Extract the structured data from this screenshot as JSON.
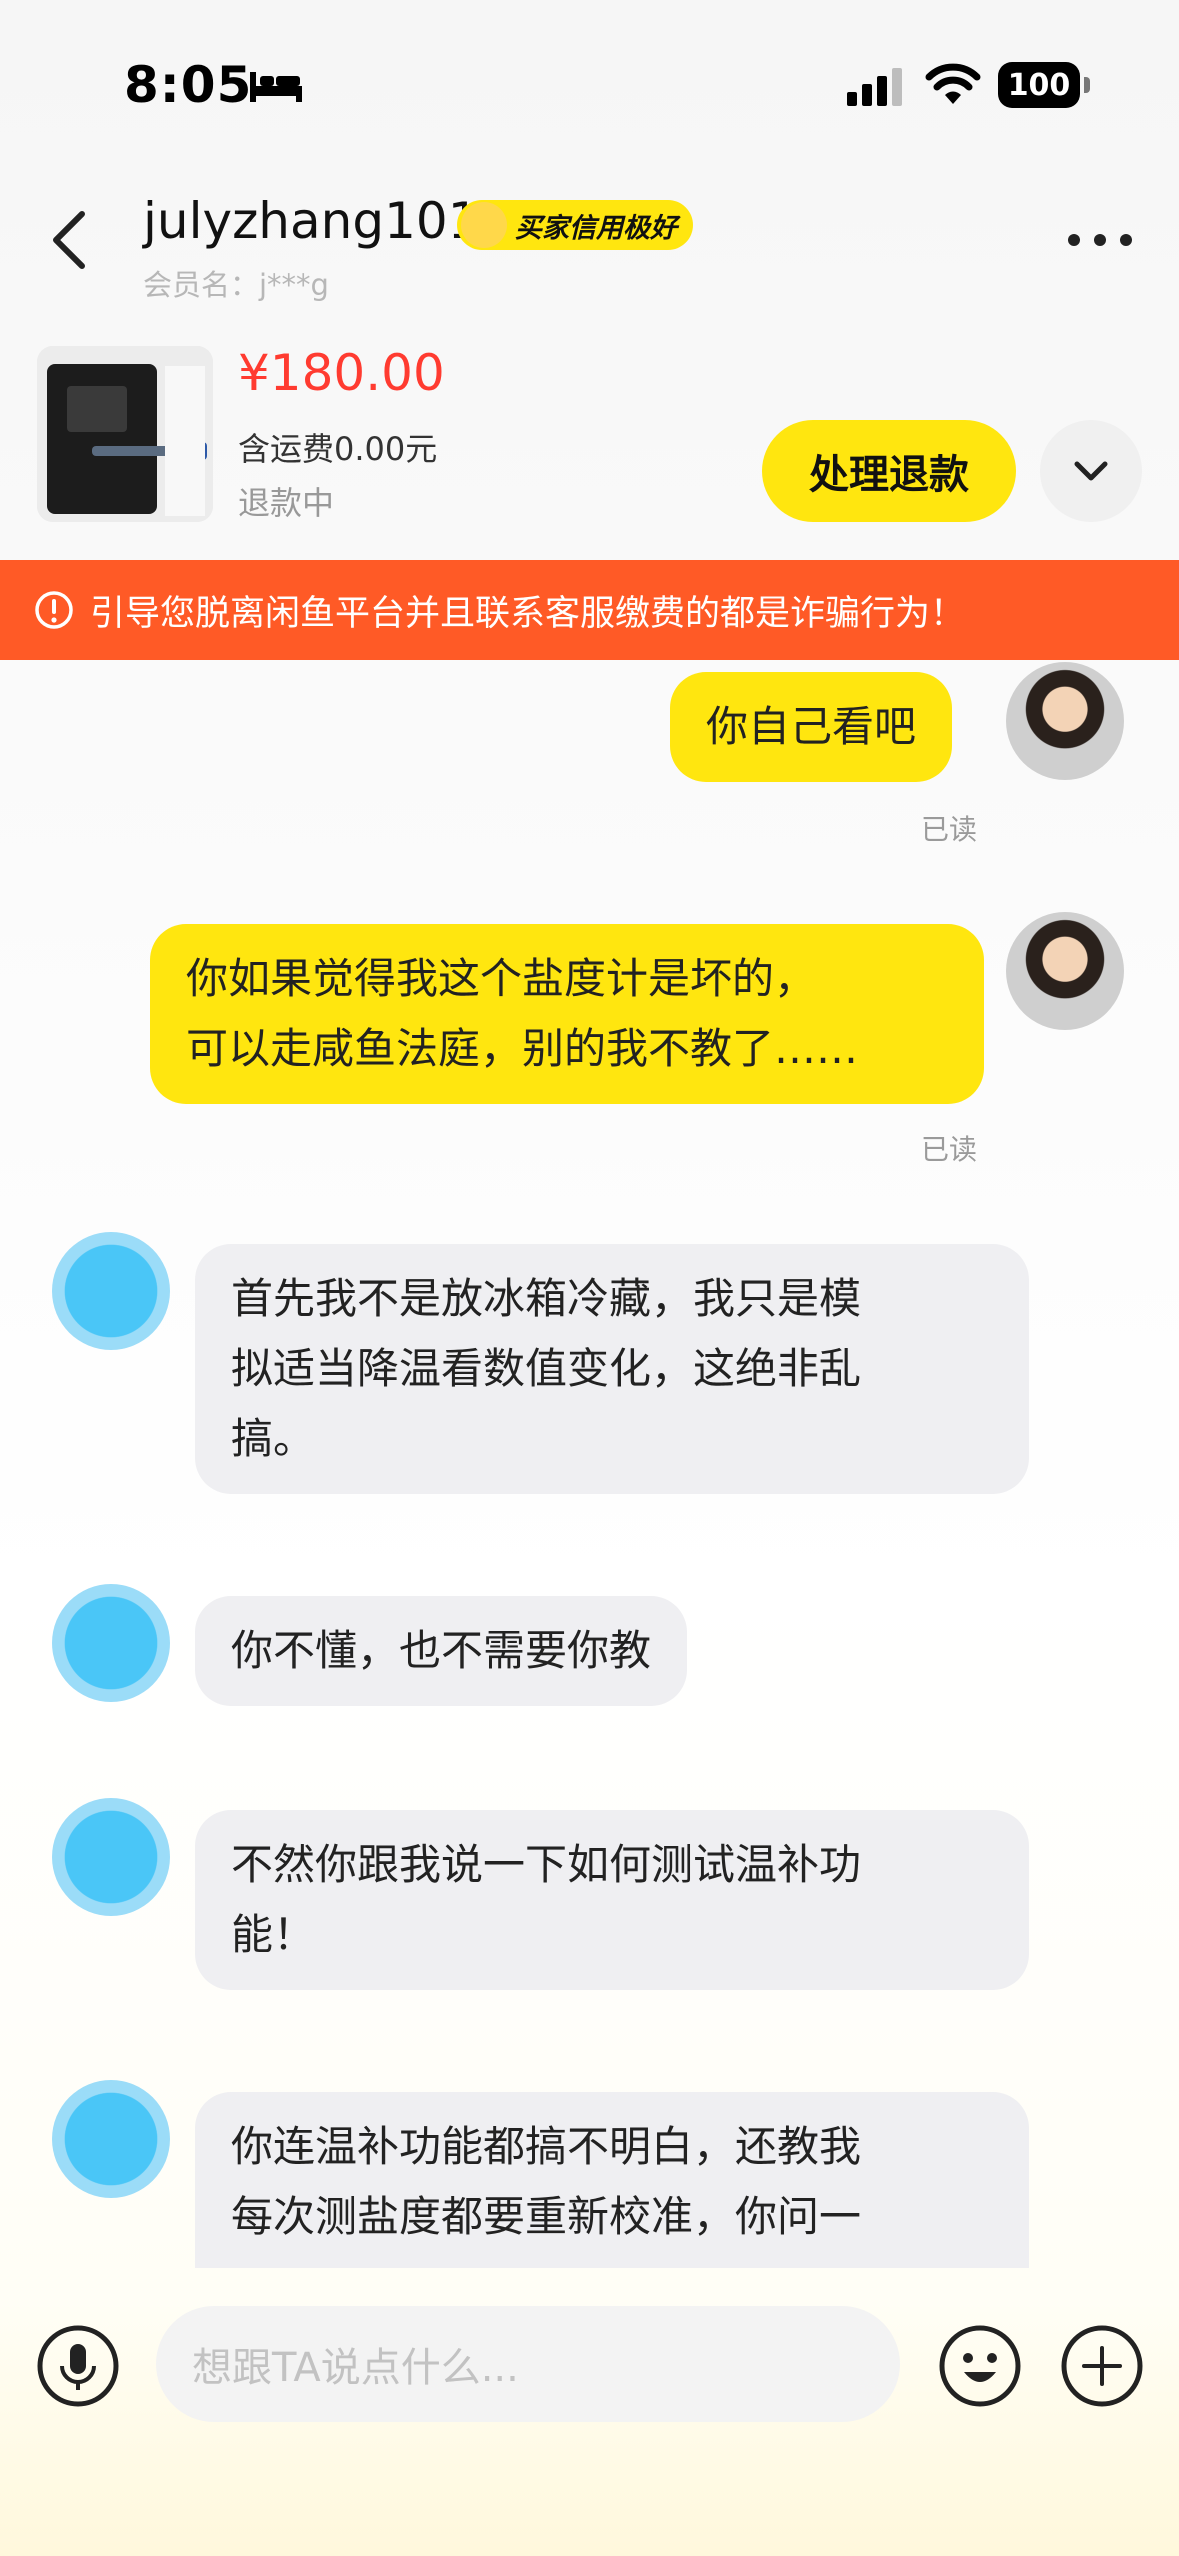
{
  "status_bar": {
    "time": "8:05",
    "battery": "100",
    "icons": [
      "bed-icon",
      "signal-icon",
      "wifi-icon",
      "battery-icon"
    ]
  },
  "header": {
    "username": "julyzhang101",
    "credit_badge": "买家信用极好",
    "member_line": "会员名：j***g",
    "icons": [
      "back-icon",
      "more-icon"
    ]
  },
  "product": {
    "price": "¥180.00",
    "shipping": "含运费0.00元",
    "status": "退款中",
    "action_button": "处理退款",
    "expand_icon": "chevron-down-icon"
  },
  "warning": {
    "text": "引导您脱离闲鱼平台并且联系客服缴费的都是诈骗行为！",
    "icon": "warning-icon"
  },
  "messages": [
    {
      "side": "mine",
      "lines": [
        "你自己看吧"
      ],
      "status": "已读"
    },
    {
      "side": "mine",
      "lines": [
        "你如果觉得我这个盐度计是坏的，",
        "可以走咸鱼法庭，别的我不教了……"
      ],
      "status": "已读"
    },
    {
      "side": "other",
      "lines": [
        "首先我不是放冰箱冷藏，我只是模",
        "拟适当降温看数值变化，这绝非乱",
        "搞。"
      ]
    },
    {
      "side": "other",
      "lines": [
        "你不懂，也不需要你教"
      ]
    },
    {
      "side": "other",
      "lines": [
        "不然你跟我说一下如何测试温补功",
        "能！"
      ]
    },
    {
      "side": "other",
      "lines": [
        "你连温补功能都搞不明白，还教我",
        "每次测盐度都要重新校准，你问一"
      ]
    }
  ],
  "input": {
    "placeholder": "想跟TA说点什么...",
    "icons": [
      "mic-icon",
      "emoji-icon",
      "plus-icon"
    ]
  },
  "colors": {
    "accent_yellow": "#ffe60f",
    "price_red": "#ff3b30",
    "warning_orange": "#ff5a26",
    "bubble_gray": "#efeff2"
  }
}
